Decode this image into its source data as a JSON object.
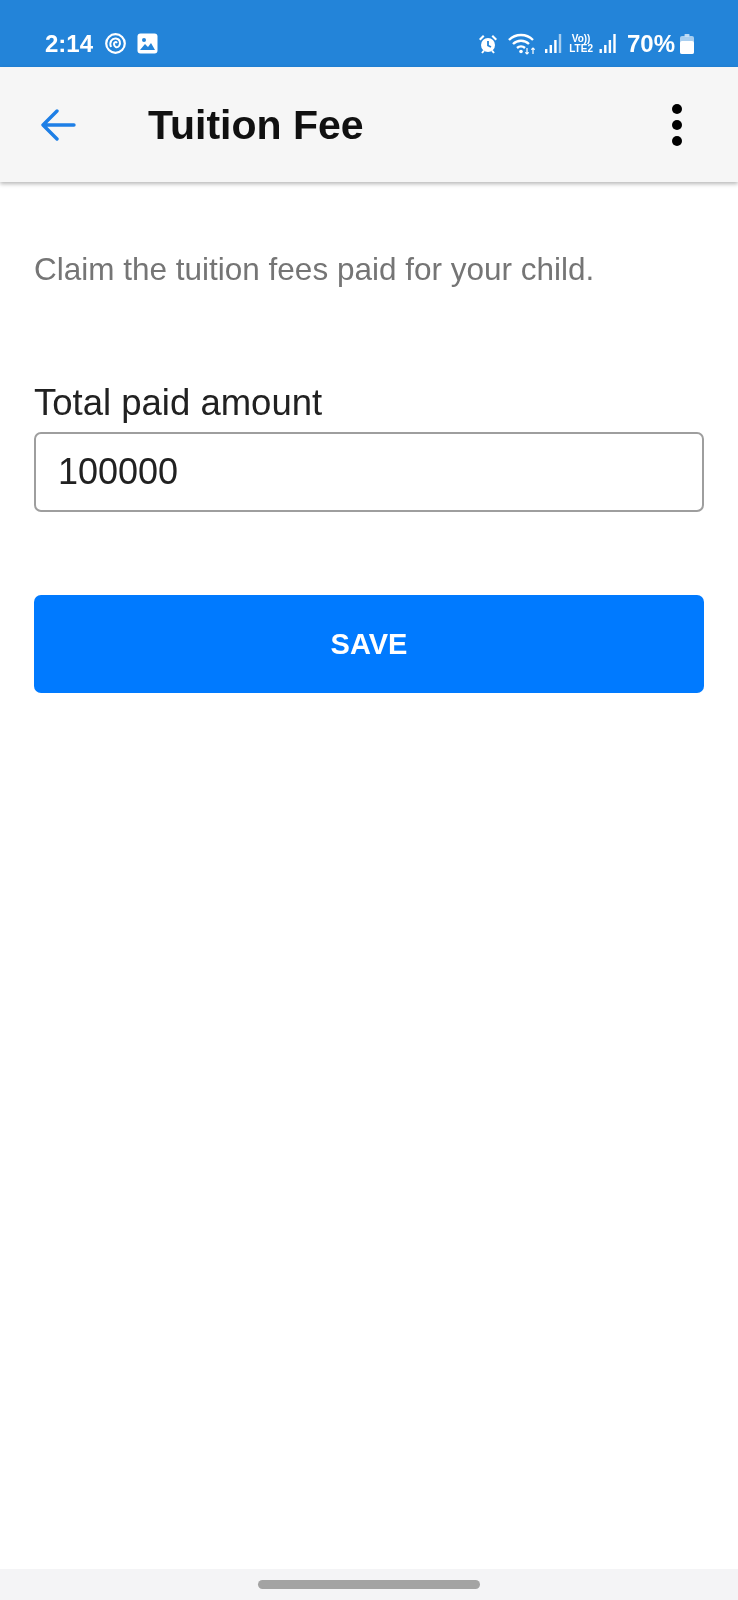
{
  "status_bar": {
    "time": "2:14",
    "volte_top": "Vo))",
    "volte_bottom": "LTE2",
    "battery": "70%"
  },
  "app_bar": {
    "title": "Tuition Fee"
  },
  "description": "Claim the tuition fees paid for your child.",
  "field": {
    "label": "Total paid amount",
    "value": "100000"
  },
  "save_button": {
    "label": "SAVE"
  }
}
